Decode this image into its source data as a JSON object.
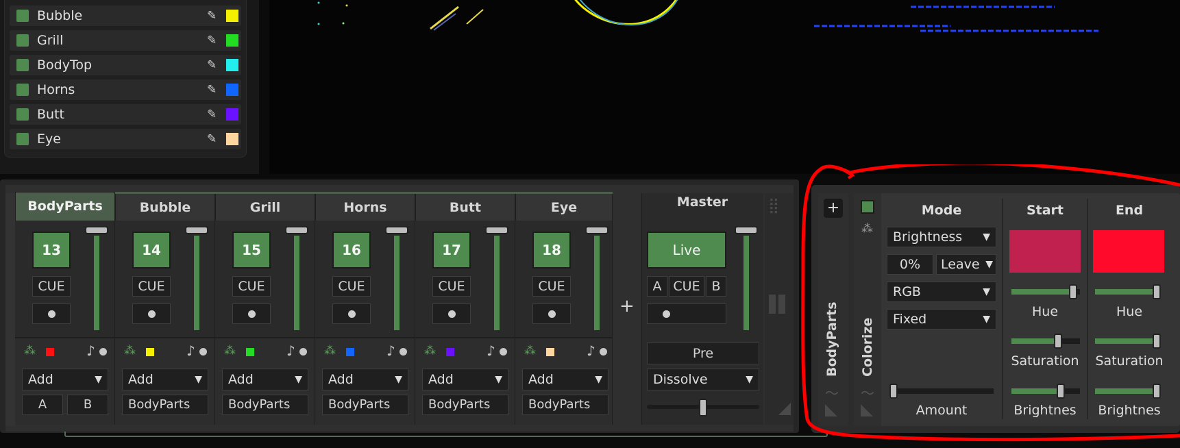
{
  "layers": [
    {
      "name": "Bubble",
      "color": "#f4f000"
    },
    {
      "name": "Grill",
      "color": "#22dd22"
    },
    {
      "name": "BodyTop",
      "color": "#22eeee"
    },
    {
      "name": "Horns",
      "color": "#1166ff"
    },
    {
      "name": "Butt",
      "color": "#6a11ff"
    },
    {
      "name": "Eye",
      "color": "#ffd6a0"
    }
  ],
  "mixer": {
    "tabs": [
      "BodyParts",
      "Bubble",
      "Grill",
      "Horns",
      "Butt",
      "Eye"
    ],
    "channels": [
      {
        "number": "13",
        "cue": "CUE",
        "color": "#ff1111",
        "blend": "Add",
        "source_a": "A",
        "source_b": "B"
      },
      {
        "number": "14",
        "cue": "CUE",
        "color": "#f4f000",
        "blend": "Add",
        "source": "BodyParts"
      },
      {
        "number": "15",
        "cue": "CUE",
        "color": "#22dd22",
        "blend": "Add",
        "source": "BodyParts"
      },
      {
        "number": "16",
        "cue": "CUE",
        "color": "#1166ff",
        "blend": "Add",
        "source": "BodyParts"
      },
      {
        "number": "17",
        "cue": "CUE",
        "color": "#6a11ff",
        "blend": "Add",
        "source": "BodyParts"
      },
      {
        "number": "18",
        "cue": "CUE",
        "color": "#ffd6a0",
        "blend": "Add",
        "source": "BodyParts"
      }
    ],
    "add_label": "+",
    "master": {
      "title": "Master",
      "live": "Live",
      "a": "A",
      "cue": "CUE",
      "b": "B",
      "pre": "Pre",
      "transition": "Dissolve"
    }
  },
  "effect": {
    "add_label": "+",
    "group_label": "BodyParts",
    "effect_label": "Colorize",
    "mode_header": "Mode",
    "start_header": "Start",
    "end_header": "End",
    "mode": "Brightness",
    "percent": "0%",
    "leave": "Leave",
    "color_space": "RGB",
    "fixed": "Fixed",
    "amount_label": "Amount",
    "start_color": "#c0214f",
    "end_color": "#ff0a2a",
    "hue_label": "Hue",
    "saturation_label": "Saturation",
    "brightness_label": "Brightnes"
  },
  "annotation_color": "#ff0000"
}
